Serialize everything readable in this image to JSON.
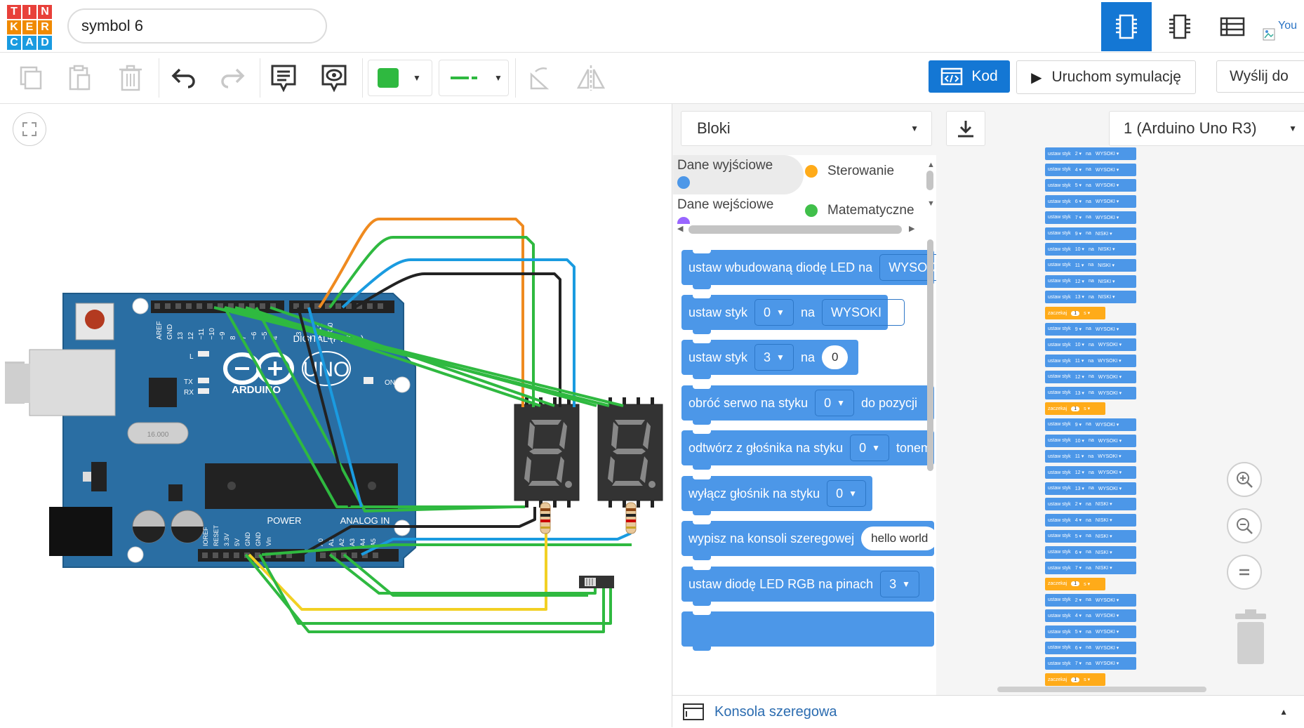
{
  "logo": {
    "letters": [
      "T",
      "I",
      "N",
      "K",
      "E",
      "R",
      "C",
      "A",
      "D"
    ],
    "colors": [
      "#e8403a",
      "#e8403a",
      "#e8403a",
      "#f08a00",
      "#f08a00",
      "#f08a00",
      "#1a9be0",
      "#1a9be0",
      "#1a9be0"
    ]
  },
  "project_title": "symbol 6",
  "topbar": {
    "broken_image_text": "You"
  },
  "toolbar": {
    "color_swatch": "#2fb940",
    "line_color": "#2fb940",
    "code_label": "Kod",
    "simulate_label": "Uruchom symulację",
    "send_label": "Wyślij do"
  },
  "code_panel": {
    "mode": "Bloki",
    "device": "1 (Arduino Uno R3)",
    "categories": [
      {
        "label": "Dane wyjściowe",
        "color": "#4c97e8"
      },
      {
        "label": "Sterowanie",
        "color": "#ffab19"
      },
      {
        "label": "Dane wejściowe",
        "color": "#9966ff"
      },
      {
        "label": "Matematyczne",
        "color": "#40bf4a"
      }
    ],
    "blocks": [
      {
        "text": "ustaw wbudowaną diodę LED na",
        "value": "WYSOKI"
      },
      {
        "prefix": "ustaw styk",
        "pin": "0",
        "mid": "na",
        "value": "WYSOKI"
      },
      {
        "prefix": "ustaw styk",
        "pin": "3",
        "mid": "na",
        "value": "0"
      },
      {
        "prefix": "obróć serwo na styku",
        "pin": "0",
        "mid": "do pozycji"
      },
      {
        "prefix": "odtwórz z głośnika na styku",
        "pin": "0",
        "mid": "tonem"
      },
      {
        "prefix": "wyłącz głośnik na styku",
        "pin": "0"
      },
      {
        "prefix": "wypisz na konsoli szeregowej",
        "value": "hello world"
      },
      {
        "prefix": "ustaw diodę LED RGB na pinach",
        "pin": "3"
      }
    ],
    "console_label": "Konsola szeregowa"
  },
  "workspace_program": [
    {
      "t": "set",
      "pin": "2",
      "v": "WYSOKI"
    },
    {
      "t": "set",
      "pin": "4",
      "v": "WYSOKI"
    },
    {
      "t": "set",
      "pin": "5",
      "v": "WYSOKI"
    },
    {
      "t": "set",
      "pin": "6",
      "v": "WYSOKI"
    },
    {
      "t": "set",
      "pin": "7",
      "v": "WYSOKI"
    },
    {
      "t": "set",
      "pin": "9",
      "v": "NISKI"
    },
    {
      "t": "set",
      "pin": "10",
      "v": "NISKI"
    },
    {
      "t": "set",
      "pin": "11",
      "v": "NISKI"
    },
    {
      "t": "set",
      "pin": "12",
      "v": "NISKI"
    },
    {
      "t": "set",
      "pin": "13",
      "v": "NISKI"
    },
    {
      "t": "wait",
      "n": "1",
      "unit": "s"
    },
    {
      "t": "set",
      "pin": "9",
      "v": "WYSOKI"
    },
    {
      "t": "set",
      "pin": "10",
      "v": "WYSOKI"
    },
    {
      "t": "set",
      "pin": "11",
      "v": "WYSOKI"
    },
    {
      "t": "set",
      "pin": "12",
      "v": "WYSOKI"
    },
    {
      "t": "set",
      "pin": "13",
      "v": "WYSOKI"
    },
    {
      "t": "wait",
      "n": "1",
      "unit": "s"
    },
    {
      "t": "set",
      "pin": "9",
      "v": "WYSOKI"
    },
    {
      "t": "set",
      "pin": "10",
      "v": "WYSOKI"
    },
    {
      "t": "set",
      "pin": "11",
      "v": "WYSOKI"
    },
    {
      "t": "set",
      "pin": "12",
      "v": "WYSOKI"
    },
    {
      "t": "set",
      "pin": "13",
      "v": "WYSOKI"
    },
    {
      "t": "set",
      "pin": "2",
      "v": "NISKI"
    },
    {
      "t": "set",
      "pin": "4",
      "v": "NISKI"
    },
    {
      "t": "set",
      "pin": "5",
      "v": "NISKI"
    },
    {
      "t": "set",
      "pin": "6",
      "v": "NISKI"
    },
    {
      "t": "set",
      "pin": "7",
      "v": "NISKI"
    },
    {
      "t": "wait",
      "n": "1",
      "unit": "s"
    },
    {
      "t": "set",
      "pin": "2",
      "v": "WYSOKI"
    },
    {
      "t": "set",
      "pin": "4",
      "v": "WYSOKI"
    },
    {
      "t": "set",
      "pin": "5",
      "v": "WYSOKI"
    },
    {
      "t": "set",
      "pin": "6",
      "v": "WYSOKI"
    },
    {
      "t": "set",
      "pin": "7",
      "v": "WYSOKI"
    },
    {
      "t": "wait",
      "n": "1",
      "unit": "s"
    }
  ],
  "workspace_labels": {
    "set": "ustaw styk",
    "on": "na",
    "wait": "zaczekaj"
  },
  "board": {
    "name": "ARDUINO",
    "model": "UNO",
    "digital_label": "DIGITAL (PWM~)",
    "power_label": "POWER",
    "analog_label": "ANALOG IN",
    "on_label": "ON",
    "chip_label": "16.000",
    "top_pins": [
      "AREF",
      "GND",
      "13",
      "12",
      "~11",
      "~10",
      "~9",
      "8",
      "7",
      "~6",
      "~5",
      "4",
      "~3",
      "2",
      "TX▸1",
      "RX◂0"
    ],
    "bottom_pins": [
      "IOREF",
      "RESET",
      "3.3V",
      "5V",
      "GND",
      "GND",
      "Vin",
      "A0",
      "A1",
      "A2",
      "A3",
      "A4",
      "A5"
    ],
    "l_label": "L",
    "tx_label": "TX",
    "rx_label": "RX"
  }
}
